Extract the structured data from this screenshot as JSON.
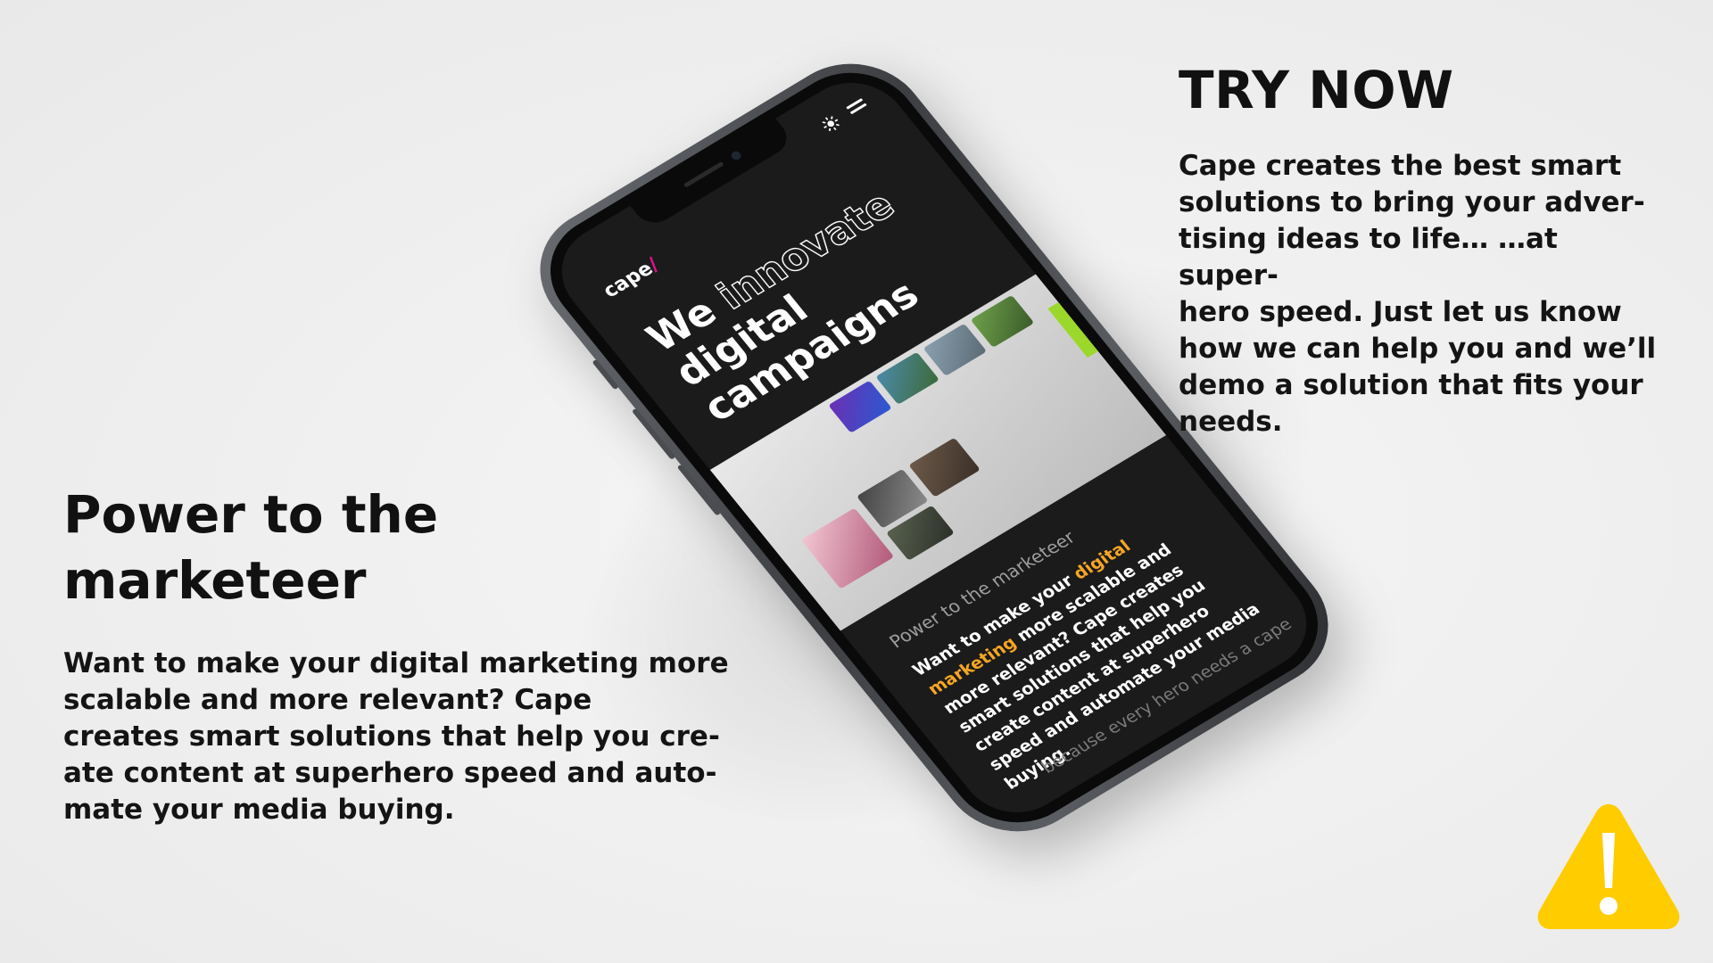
{
  "right_section": {
    "title": "TRY NOW",
    "body": "Cape creates the best smart\nsolutions to bring your adver-\ntising ideas to life… …at super-\nhero speed. Just let us know\nhow we can help you and we’ll\ndemo a solution that fits your\nneeds."
  },
  "left_section": {
    "title": "Power to the\nmarketeer",
    "body": "Want to make your digital marketing more\nscalable and more relevant? Cape\ncreates smart solutions that help you cre-\nate content at superhero speed and auto-\nmate your media buying."
  },
  "phone_screen": {
    "logo": "cape",
    "logo_slash": "/",
    "hero_we": "We",
    "hero_innovate": "innovate",
    "hero_digital": "digital",
    "hero_campaigns": "campaigns",
    "subtitle": "Power to the marketeer",
    "body_pre": "Want to make your ",
    "body_highlight": "digital marketing",
    "body_post": " more scalable and more relevant? Cape creates smart solutions that help you create content at superhero speed and automate your media buying.",
    "footer": "because every hero needs a cape"
  },
  "icons": {
    "warning": "warning-triangle-icon",
    "sun": "sun-icon",
    "menu": "hamburger-menu-icon"
  },
  "colors": {
    "background": "#efefef",
    "text": "#111111",
    "warning": "#ffcc00",
    "highlight": "#f6a623",
    "brand_accent": "#e0138c"
  }
}
